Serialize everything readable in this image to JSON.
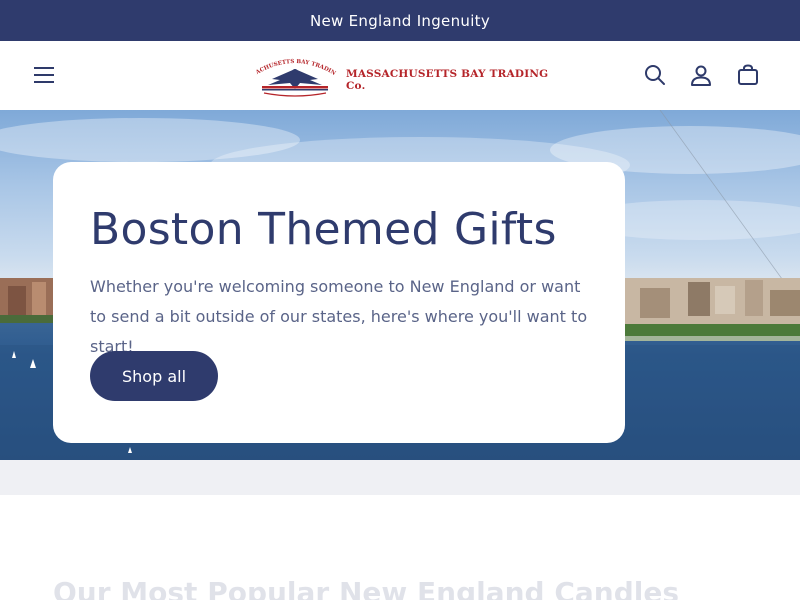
{
  "announcement": {
    "text": "New England Ingenuity"
  },
  "header": {
    "logo_text": "MASSACHUSETTS BAY TRADING Co.",
    "logo_arc_text": "MASSACHUSETTS BAY TRADING Co.",
    "icons": [
      "menu-icon",
      "search-icon",
      "account-icon",
      "cart-icon"
    ]
  },
  "hero": {
    "title": "Boston Themed Gifts",
    "subtitle": "Whether you're welcoming someone to New England or want to send a bit outside of our states, here's where you'll want to start!",
    "button_label": "Shop all"
  },
  "section": {
    "title": "Our Most Popular New England Candles"
  },
  "colors": {
    "brand_navy": "#2f3b6d",
    "logo_red": "#b5252a",
    "band_gray": "#eff0f4"
  }
}
